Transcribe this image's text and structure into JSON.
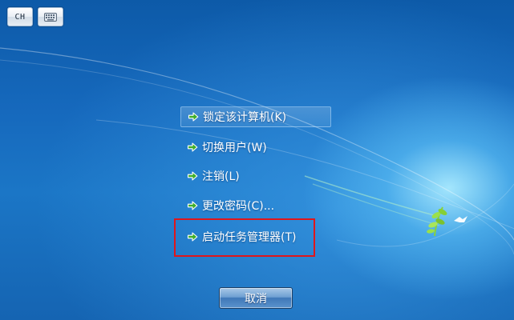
{
  "toolbar": {
    "language_label": "CH",
    "keyboard_icon": "keyboard-icon"
  },
  "menu": {
    "items": [
      {
        "label": "锁定该计算机(K)",
        "icon": "green-arrow-icon"
      },
      {
        "label": "切换用户(W)",
        "icon": "green-arrow-icon"
      },
      {
        "label": "注销(L)",
        "icon": "green-arrow-icon"
      },
      {
        "label": "更改密码(C)...",
        "icon": "green-arrow-icon"
      },
      {
        "label": "启动任务管理器(T)",
        "icon": "green-arrow-icon"
      }
    ]
  },
  "cancel_button": {
    "label": "取消"
  },
  "colors": {
    "highlight_box": "#e0161b",
    "arrow": "#3fae2a",
    "text": "#ffffff"
  }
}
